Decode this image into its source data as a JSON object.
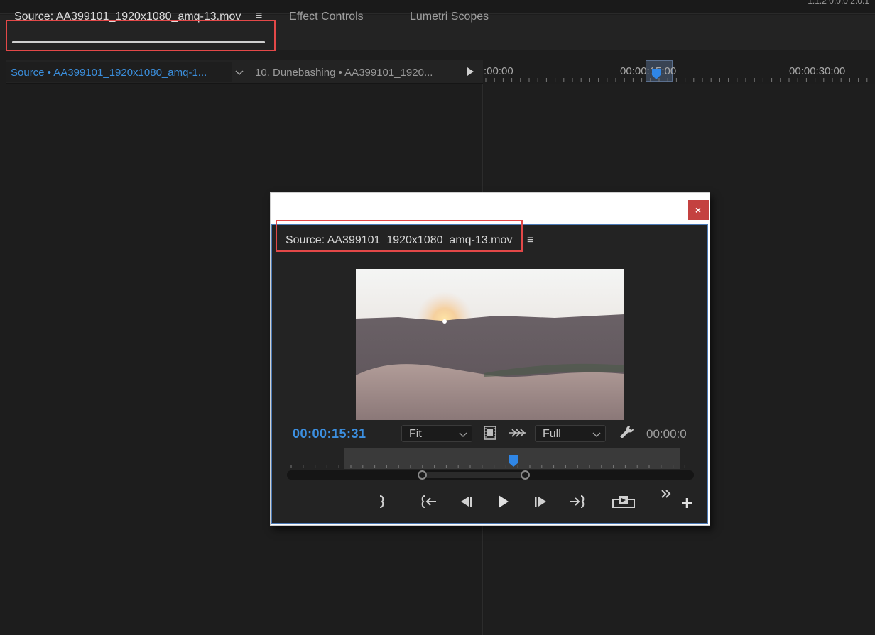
{
  "top_strip": {
    "partial_text": "1:1.2 0.0.0 2.0.1"
  },
  "tabs": {
    "source_label": "Source: AA399101_1920x1080_amq-13.mov",
    "effect_controls": "Effect Controls",
    "lumetri_scopes": "Lumetri Scopes",
    "menu_glyph": "≡"
  },
  "source_panel": {
    "source_dropdown_label": "Source • AA399101_1920x1080_amq-1...",
    "sequence_label": "10. Dunebashing • AA399101_1920..."
  },
  "timeline_ruler": {
    "tc_start": ":00:00",
    "tc_mid": "00:00:15:00",
    "tc_end": "00:00:30:00"
  },
  "floating_window": {
    "close_label": "×",
    "title": "Source: AA399101_1920x1080_amq-13.mov",
    "menu_glyph": "≡",
    "timecode": "00:00:15:31",
    "fit_value": "Fit",
    "resolution_value": "Full",
    "duration_partial": "00:00:0",
    "scrub_position": 0.5
  },
  "colors": {
    "accent_blue": "#3c8fe0",
    "highlight_red": "#e34848",
    "close_red": "#c44140",
    "panel_bg": "#232323"
  },
  "icons": {
    "chevron": "chevron-down-icon",
    "play": "play-icon",
    "filmstrip": "filmstrip-icon",
    "wrench": "wrench-icon",
    "add": "plus-icon"
  }
}
